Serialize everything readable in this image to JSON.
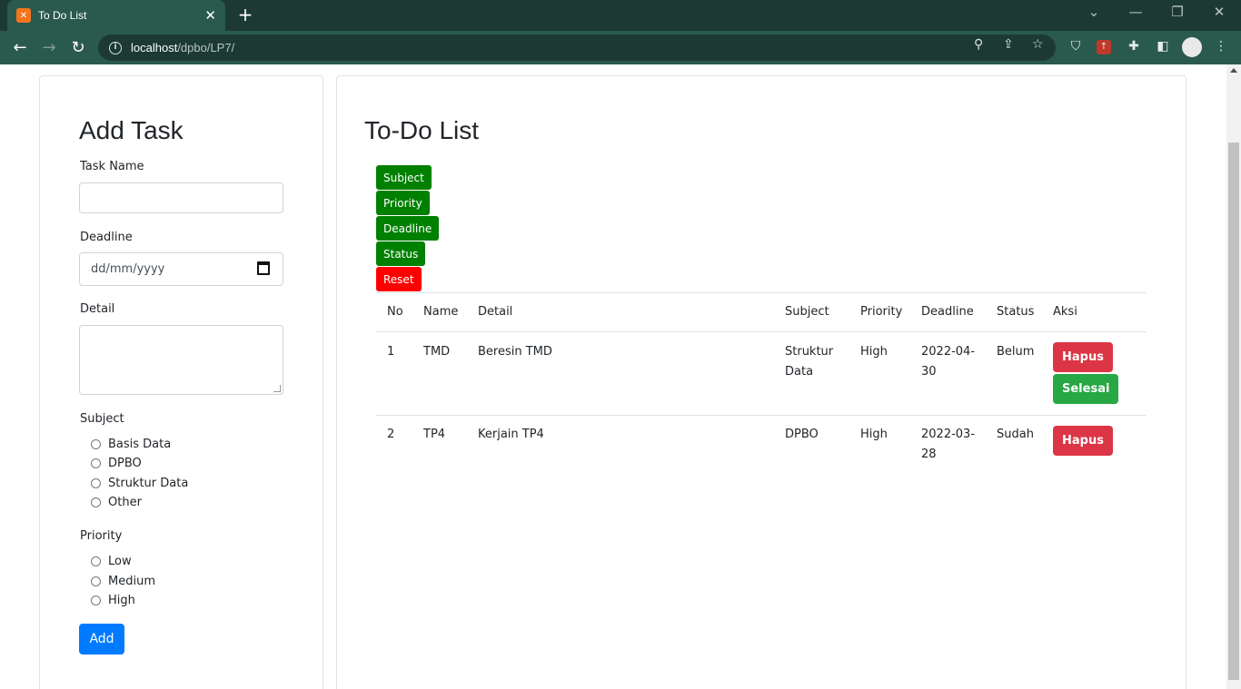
{
  "browser": {
    "tab_title": "To Do List",
    "url_host": "localhost",
    "url_path": "/dpbo/LP7/"
  },
  "form": {
    "title": "Add Task",
    "task_name_label": "Task Name",
    "deadline_label": "Deadline",
    "deadline_placeholder": "dd/mm/yyyy",
    "detail_label": "Detail",
    "subject_label": "Subject",
    "subjects": [
      "Basis Data",
      "DPBO",
      "Struktur Data",
      "Other"
    ],
    "priority_label": "Priority",
    "priorities": [
      "Low",
      "Medium",
      "High"
    ],
    "add_label": "Add"
  },
  "list": {
    "title": "To-Do List",
    "sort_buttons": [
      "Subject",
      "Priority",
      "Deadline",
      "Status"
    ],
    "reset_label": "Reset",
    "columns": [
      "No",
      "Name",
      "Detail",
      "Subject",
      "Priority",
      "Deadline",
      "Status",
      "Aksi"
    ],
    "rows": [
      {
        "no": "1",
        "name": "TMD",
        "detail": "Beresin TMD",
        "subject_l1": "Struktur",
        "subject_l2": "Data",
        "priority": "High",
        "deadline_l1": "2022-04-",
        "deadline_l2": "30",
        "status": "Belum",
        "hapus": "Hapus",
        "selesai": "Selesai"
      },
      {
        "no": "2",
        "name": "TP4",
        "detail": "Kerjain TP4",
        "subject_l1": "DPBO",
        "subject_l2": "",
        "priority": "High",
        "deadline_l1": "2022-03-",
        "deadline_l2": "28",
        "status": "Sudah",
        "hapus": "Hapus"
      }
    ]
  },
  "colors": {
    "sort_green": "#008000",
    "reset_red": "#ff0000",
    "danger": "#dc3545",
    "success": "#28a745",
    "primary": "#007bff"
  }
}
